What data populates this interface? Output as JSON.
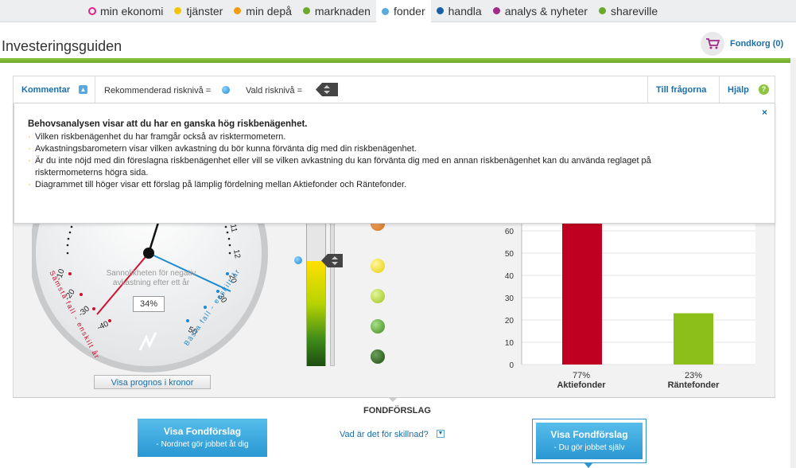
{
  "nav": {
    "items": [
      {
        "label": "min ekonomi",
        "color": "#e0218a",
        "ring": true
      },
      {
        "label": "tjänster",
        "color": "#f5c400"
      },
      {
        "label": "min depå",
        "color": "#f39c12"
      },
      {
        "label": "marknaden",
        "color": "#6aaa2a"
      },
      {
        "label": "fonder",
        "color": "#5aa9dd",
        "active": true
      },
      {
        "label": "handla",
        "color": "#1a5fa8"
      },
      {
        "label": "analys & nyheter",
        "color": "#a12a8a"
      },
      {
        "label": "shareville",
        "color": "#6aaa2a"
      }
    ]
  },
  "header": {
    "title": "Investeringsguiden",
    "cart_label": "Fondkorg (0)"
  },
  "toolbar": {
    "kommentar": "Kommentar",
    "rekommenderad": "Rekommenderad risknivå =",
    "vald": "Vald risknivå =",
    "till_fragorna": "Till frågorna",
    "hjalp": "Hjälp"
  },
  "comment": {
    "close": "×",
    "heading": "Behovsanalysen visar att du har en ganska hög riskbenägenhet.",
    "bullets": [
      "Vilken riskbenägenhet du har framgår också av risktermometern.",
      "Avkastningsbarometern visar vilken avkastning du bör kunna förvänta dig med din riskbenägenhet.",
      "Är du inte nöjd med din föreslagna riskbenägenhet eller vill se vilken avkastning du kan förvänta dig med en annan riskbenägenhet kan du använda reglaget på risktermometerns högra sida.",
      "Diagrammet till höger visar ett förslag på lämplig fördelning mellan Aktiefonder och Räntefonder."
    ]
  },
  "gauge": {
    "label": "Sannolikheten för negativ avkastning efter ett år",
    "value": "34%",
    "left_ticks": [
      "-10",
      "-20",
      "-30",
      "-40"
    ],
    "right_ticks": [
      "11",
      "12",
      "20",
      "30",
      "50"
    ],
    "left_arc": "Sämsta fall - enskilt år",
    "right_arc": "Bästa fall - enskilt år",
    "prognos_button": "Visa prognos i kronor"
  },
  "chart_data": {
    "type": "bar",
    "categories": [
      "Aktiefonder",
      "Räntefonder"
    ],
    "values": [
      77,
      23
    ],
    "value_labels": [
      "77%",
      "23%"
    ],
    "y_ticks": [
      0,
      10,
      20,
      30,
      40,
      50,
      60
    ],
    "ylim": [
      0,
      100
    ],
    "grid": true,
    "colors": [
      "#c00020",
      "#8cbf1a"
    ]
  },
  "fondforslag": {
    "title": "FONDFÖRSLAG",
    "left_btn": {
      "title": "Visa Fondförslag",
      "sub": "- Nordnet gör jobbet åt dig"
    },
    "right_btn": {
      "title": "Visa Fondförslag",
      "sub": "- Du gör jobbet själv"
    },
    "link": "Vad är det för skillnad?"
  }
}
